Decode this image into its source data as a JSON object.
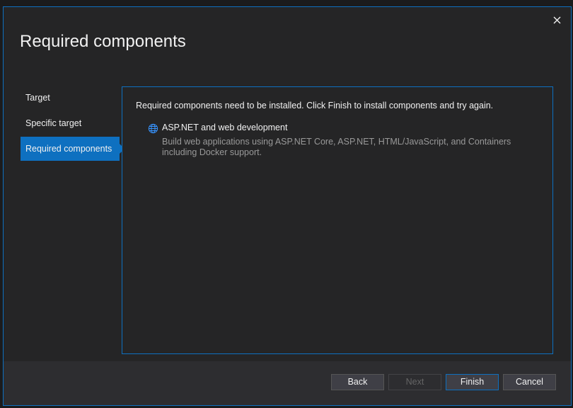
{
  "window": {
    "title": "Required components",
    "close_icon": "close-icon"
  },
  "nav": {
    "items": [
      {
        "label": "Target",
        "active": false
      },
      {
        "label": "Specific target",
        "active": false
      },
      {
        "label": "Required components",
        "active": true
      }
    ]
  },
  "panel": {
    "message": "Required components need to be installed. Click Finish to install components and try again.",
    "component": {
      "icon": "globe-icon",
      "title": "ASP.NET and web development",
      "description": "Build web applications using ASP.NET Core, ASP.NET, HTML/JavaScript, and Containers including Docker support."
    }
  },
  "buttons": {
    "back": "Back",
    "next": "Next",
    "finish": "Finish",
    "cancel": "Cancel"
  },
  "colors": {
    "accent": "#0e70c0",
    "background": "#252526",
    "footer": "#2d2d30"
  }
}
